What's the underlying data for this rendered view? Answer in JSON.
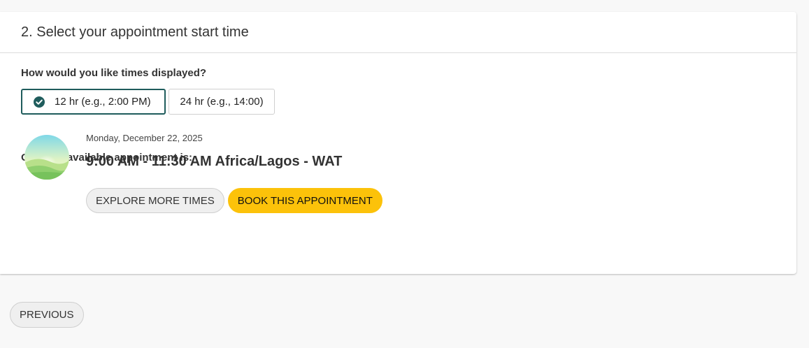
{
  "step": {
    "title": "2. Select your appointment start time"
  },
  "time_format": {
    "question": "How would you like times displayed?",
    "options": [
      {
        "label": "12 hr (e.g., 2:00 PM)",
        "selected": true
      },
      {
        "label": "24 hr (e.g., 14:00)",
        "selected": false
      }
    ],
    "selected_icon": "check-circle-icon"
  },
  "next_appointment": {
    "label": "Our next available appointment is:",
    "date": "Monday, December 22, 2025",
    "time_range": "9:00 AM - 11:30 AM Africa/Lagos - WAT",
    "image_icon": "landscape-avatar-icon",
    "explore_label": "EXPLORE MORE TIMES",
    "book_label": "BOOK THIS APPOINTMENT"
  },
  "navigation": {
    "previous_label": "PREVIOUS"
  },
  "colors": {
    "accent_teal": "#1f5c5c",
    "book_button": "#fcc20a",
    "page_background": "#f8f8f8"
  }
}
